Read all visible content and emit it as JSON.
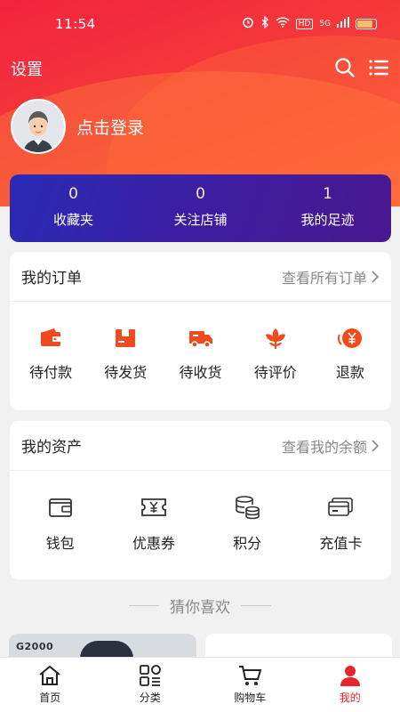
{
  "status_bar": {
    "time": "11:54",
    "signal": "5G",
    "hd": "HD",
    "battery": "77"
  },
  "header": {
    "title": "设置"
  },
  "profile": {
    "login_text": "点击登录"
  },
  "stats": [
    {
      "value": "0",
      "label": "收藏夹"
    },
    {
      "value": "0",
      "label": "关注店铺"
    },
    {
      "value": "1",
      "label": "我的足迹"
    }
  ],
  "orders": {
    "title": "我的订单",
    "link": "查看所有订单",
    "items": [
      {
        "label": "待付款",
        "icon": "wallet-icon"
      },
      {
        "label": "待发货",
        "icon": "box-icon"
      },
      {
        "label": "待收货",
        "icon": "truck-icon"
      },
      {
        "label": "待评价",
        "icon": "flower-icon"
      },
      {
        "label": "退款",
        "icon": "refund-yen-icon"
      }
    ]
  },
  "assets": {
    "title": "我的资产",
    "link": "查看我的余额",
    "items": [
      {
        "label": "钱包",
        "icon": "wallet-outline-icon"
      },
      {
        "label": "优惠券",
        "icon": "coupon-icon"
      },
      {
        "label": "积分",
        "icon": "coins-icon"
      },
      {
        "label": "充值卡",
        "icon": "card-icon"
      }
    ]
  },
  "recommend": {
    "title": "猜你喜欢",
    "brand": "G2000"
  },
  "tabbar": [
    {
      "label": "首页",
      "icon": "home-icon",
      "active": false
    },
    {
      "label": "分类",
      "icon": "category-icon",
      "active": false
    },
    {
      "label": "购物车",
      "icon": "cart-icon",
      "active": false
    },
    {
      "label": "我的",
      "icon": "user-icon",
      "active": true
    }
  ],
  "colors": {
    "primary_red": "#f2233d",
    "accent_orange": "#f04a1e",
    "stats_purple": "#3b1fa3",
    "active_tab": "#e8232b"
  }
}
